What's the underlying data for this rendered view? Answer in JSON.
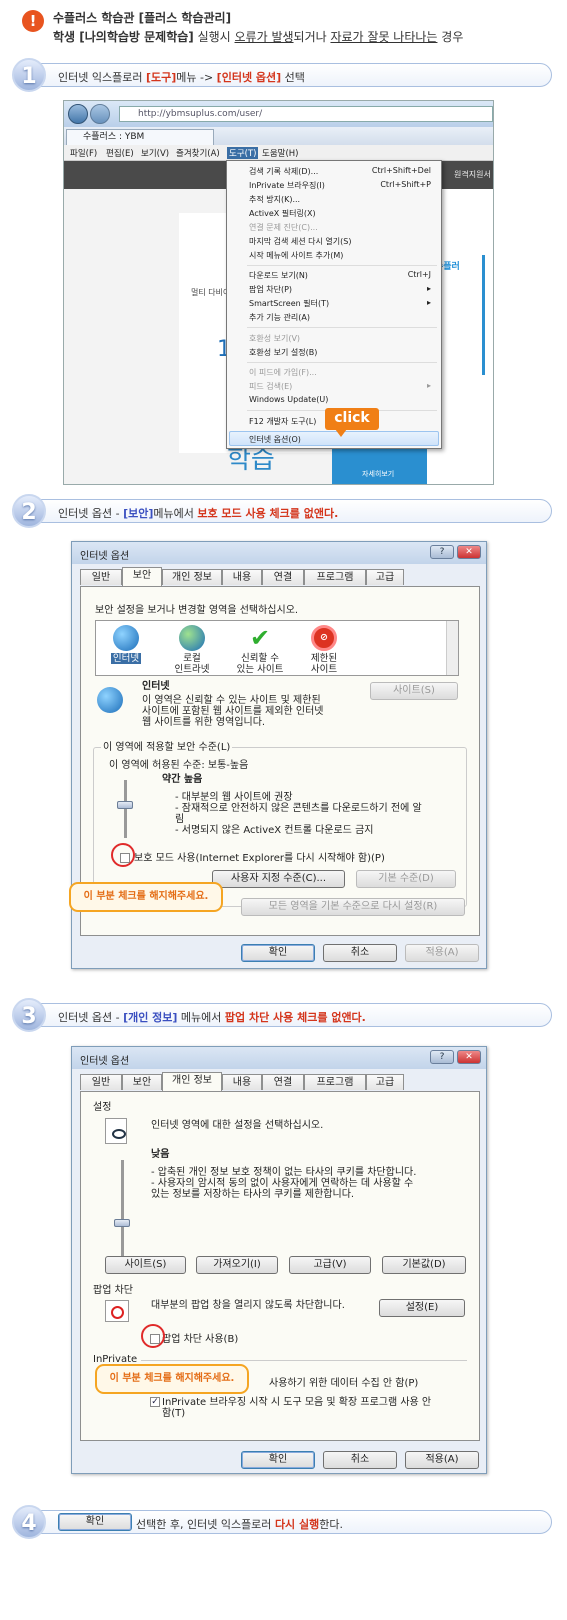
{
  "header": {
    "icon": "!",
    "title": "수플러스 학습관 [플러스 학습관리]",
    "subtitle_prefix": "학생 [나의학습방 문제학습]",
    "subtitle_mid1": " 실행시 ",
    "subtitle_u1": "오류가 발생",
    "subtitle_mid2": "되거나 ",
    "subtitle_u2": "자료가 잘못 나타나는",
    "subtitle_suffix": " 경우"
  },
  "steps": [
    {
      "num": "1",
      "parts": [
        "인터넷 익스플로러 ",
        "[도구]",
        "메뉴 -> ",
        "[인터넷 옵션]",
        " 선택"
      ]
    },
    {
      "num": "2",
      "parts": [
        "인터넷 옵션 - ",
        "[보안]",
        "메뉴에서  ",
        "보호 모드 사용 체크를 없앤다."
      ]
    },
    {
      "num": "3",
      "parts": [
        "인터넷 옵션 - ",
        "[개인 정보]",
        " 메뉴에서 ",
        "팝업 차단 사용 체크를 없앤다."
      ]
    },
    {
      "num": "4",
      "button": "확인",
      "parts": [
        " 선택한 후, 인터넷 익스플로러 ",
        "다시 실행",
        "한다."
      ]
    }
  ],
  "browser": {
    "url": "http://ybmsuplus.com/user/",
    "tab": "수플러스 : YBM",
    "menubar": [
      "파일(F)",
      "편집(E)",
      "보기(V)",
      "즐겨찾기(A)",
      "도구(T)",
      "도움말(H)"
    ],
    "page_right_text": "원격지원서",
    "page_blue_text": "수플러",
    "page_label": "멀티 다비아",
    "page_big_text": "학습",
    "page_num": "1",
    "page_small_btn": "자세히보기",
    "tools_menu": [
      {
        "label": "검색 기록 삭제(D)...",
        "shortcut": "Ctrl+Shift+Del"
      },
      {
        "label": "InPrivate 브라우징(I)",
        "shortcut": "Ctrl+Shift+P"
      },
      {
        "label": "추적 방지(K)..."
      },
      {
        "label": "ActiveX 필터링(X)"
      },
      {
        "label": "연결 문제 진단(C)...",
        "disabled": true
      },
      {
        "label": "마지막 검색 세션 다시 열기(S)"
      },
      {
        "label": "시작 메뉴에 사이트 추가(M)"
      },
      {
        "label": "다운로드 보기(N)",
        "shortcut": "Ctrl+J"
      },
      {
        "label": "팝업 차단(P)",
        "arrow": "▸"
      },
      {
        "label": "SmartScreen 필터(T)",
        "arrow": "▸"
      },
      {
        "label": "추가 기능 관리(A)"
      },
      {
        "label": "호환성 보기(V)",
        "disabled": true
      },
      {
        "label": "호환성 보기 설정(B)"
      },
      {
        "label": "이 피드에 가입(F)...",
        "disabled": true
      },
      {
        "label": "피드 검색(E)",
        "disabled": true,
        "arrow": "▸"
      },
      {
        "label": "Windows Update(U)"
      },
      {
        "label": "F12 개발자 도구(L)"
      },
      {
        "label": "인터넷 옵션(O)"
      }
    ],
    "click_label": "click"
  },
  "dialog_security": {
    "title": "인터넷 옵션",
    "tabs": [
      "일반",
      "보안",
      "개인 정보",
      "내용",
      "연결",
      "프로그램",
      "고급"
    ],
    "select_zone_text": "보안 설정을 보거나 변경할 영역을 선택하십시오.",
    "zones": [
      [
        "인터넷",
        ""
      ],
      [
        "로컬",
        "인트라넷"
      ],
      [
        "신뢰할 수",
        "있는 사이트"
      ],
      [
        "제한된",
        "사이트"
      ]
    ],
    "zone_name": "인터넷",
    "zone_desc": [
      "이 영역은 신뢰할 수 있는 사이트 및 제한된",
      "사이트에 포함된 웹 사이트를 제외한 인터넷",
      "웹 사이트를 위한 영역입니다."
    ],
    "sites_button": "사이트(S)",
    "level_group": "이 영역에 적용할 보안 수준(L)",
    "allowed_levels": "이 영역에 허용된 수준: 보통-높음",
    "level_name": "약간 높음",
    "level_bullets": [
      "- 대부분의 웹 사이트에 권장",
      "- 잠재적으로 안전하지 않은 콘텐츠를 다운로드하기 전에 알",
      "  림",
      "- 서명되지 않은 ActiveX 컨트롤 다운로드 금지"
    ],
    "protected_mode": "보호 모드 사용(Internet Explorer를 다시 시작해야 함)(P)",
    "custom_level": "사용자 지정 수준(C)...",
    "default_level": "기본 수준(D)",
    "reset_all": "모든 영역을 기본 수준으로 다시 설정(R)",
    "ok": "확인",
    "cancel": "취소",
    "apply": "적용(A)",
    "bubble": "이 부분 체크를 해지해주세요."
  },
  "dialog_privacy": {
    "title": "인터넷 옵션",
    "tabs": [
      "일반",
      "보안",
      "개인 정보",
      "내용",
      "연결",
      "프로그램",
      "고급"
    ],
    "settings_label": "설정",
    "select_text": "인터넷 영역에 대한 설정을 선택하십시오.",
    "level_name": "낮음",
    "level_desc": [
      "- 압축된 개인 정보 보호 정책이 없는 타사의 쿠키를 차단합니다.",
      "- 사용자의 암시적 동의 없이 사용자에게 연락하는 데 사용할 수",
      "  있는 정보를 저장하는 타사의 쿠키를 제한합니다."
    ],
    "buttons": [
      "사이트(S)",
      "가져오기(I)",
      "고급(V)",
      "기본값(D)"
    ],
    "popup_label": "팝업 차단",
    "popup_desc": "대부분의 팝업 창을 열리지 않도록 차단합니다.",
    "popup_settings": "설정(E)",
    "popup_check": "팝업 차단 사용(B)",
    "inprivate_label": "InPrivate",
    "inprivate_text1": "사용하기 위한 데이터 수집 안 함(P)",
    "inprivate_text2": "InPrivate 브라우징 시작 시 도구 모음 및 확장 프로그램 사용 안",
    "inprivate_text3": "함(T)",
    "ok": "확인",
    "cancel": "취소",
    "apply": "적용(A)",
    "bubble": "이 부분 체크를 해지해주세요."
  }
}
